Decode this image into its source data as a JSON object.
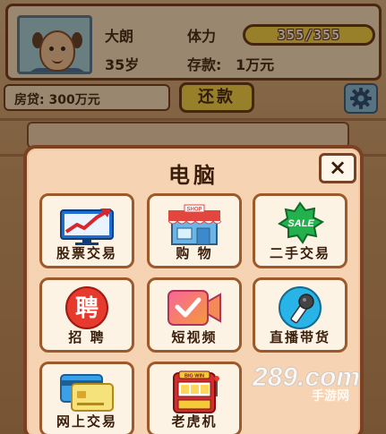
{
  "profile": {
    "name": "大朗",
    "age": "35岁",
    "stamina_label": "体力",
    "stamina_value": "355/355",
    "savings_label": "存款:",
    "savings_value": "1万元"
  },
  "loan": {
    "text": "房贷: 300万元"
  },
  "repay_button": "还款",
  "modal": {
    "title": "电脑",
    "close_label": "×",
    "apps": [
      {
        "label": "股票交易",
        "icon": "stock-chart-icon"
      },
      {
        "label": "购 物",
        "icon": "shop-icon"
      },
      {
        "label": "二手交易",
        "icon": "sale-badge-icon"
      },
      {
        "label": "招 聘",
        "icon": "recruit-icon"
      },
      {
        "label": "短视频",
        "icon": "video-icon"
      },
      {
        "label": "直播带货",
        "icon": "microphone-icon"
      },
      {
        "label": "网上交易",
        "icon": "credit-card-icon"
      },
      {
        "label": "老虎机",
        "icon": "slot-machine-icon"
      }
    ]
  },
  "icon_texts": {
    "shop_sign": "SHOP",
    "sale_badge": "SALE",
    "recruit_char": "聘",
    "slot_sign": "BIG WIN"
  },
  "watermark": {
    "main": "289.com",
    "sub": "手游网"
  },
  "colors": {
    "accent_yellow": "#f5d94a",
    "border_brown": "#7a4124",
    "panel_bg": "#f6d4b3"
  }
}
